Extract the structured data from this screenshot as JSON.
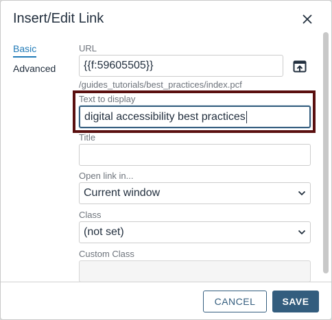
{
  "dialog": {
    "title": "Insert/Edit Link"
  },
  "tabs": [
    {
      "label": "Basic",
      "active": true
    },
    {
      "label": "Advanced",
      "active": false
    }
  ],
  "fields": {
    "url": {
      "label": "URL",
      "value": "{{f:59605505}}",
      "path": "/guides_tutorials/best_practices/index.pcf"
    },
    "text_to_display": {
      "label": "Text to display",
      "value": "digital accessibility best practices"
    },
    "title": {
      "label": "Title",
      "value": ""
    },
    "open_link_in": {
      "label": "Open link in...",
      "selected": "Current window"
    },
    "class": {
      "label": "Class",
      "selected": "(not set)"
    },
    "custom_class": {
      "label": "Custom Class",
      "value": ""
    }
  },
  "footer": {
    "cancel_label": "CANCEL",
    "save_label": "SAVE"
  },
  "colors": {
    "primary": "#335d7e",
    "tab_active": "#207ab7",
    "highlight_border": "#5a0f0f"
  },
  "icons": {
    "close": "close-icon",
    "browse": "browse-icon",
    "select_arrow": "chevron-down-icon"
  }
}
